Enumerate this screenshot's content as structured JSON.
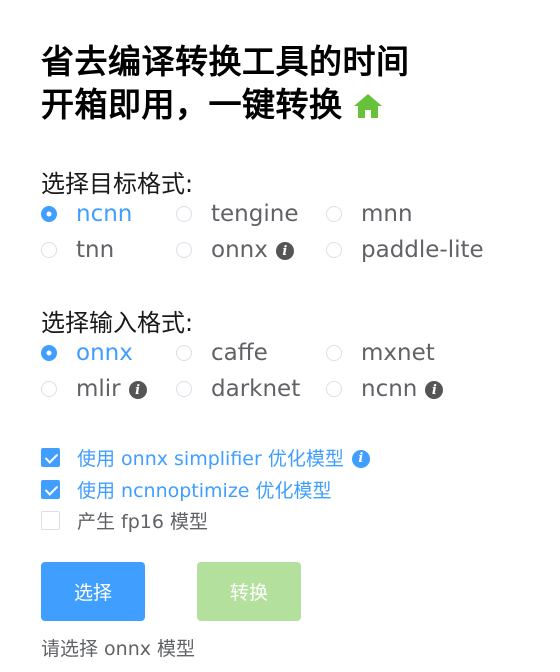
{
  "header": {
    "title_line1": "省去编译转换工具的时间",
    "title_line2": "开箱即用，一键转换",
    "icon": "home-icon",
    "icon_color": "#67c23a"
  },
  "target_format": {
    "label": "选择目标格式:",
    "selected": "ncnn",
    "options": [
      "ncnn",
      "tengine",
      "mnn",
      "tnn",
      "onnx",
      "paddle-lite"
    ]
  },
  "input_format": {
    "label": "选择输入格式:",
    "selected": "onnx",
    "options": [
      "onnx",
      "caffe",
      "mxnet",
      "mlir",
      "darknet",
      "ncnn"
    ]
  },
  "options": {
    "onnx_simplifier": {
      "label": "使用 onnx simplifier 优化模型",
      "checked": true
    },
    "ncnnoptimize": {
      "label": "使用 ncnnoptimize 优化模型",
      "checked": true
    },
    "fp16": {
      "label": "产生 fp16 模型",
      "checked": false
    }
  },
  "buttons": {
    "select_label": "选择",
    "convert_label": "转换"
  },
  "status_text": "请选择 onnx 模型",
  "colors": {
    "primary": "#409eff",
    "success_disabled": "#b3e19d",
    "text": "#606266"
  }
}
